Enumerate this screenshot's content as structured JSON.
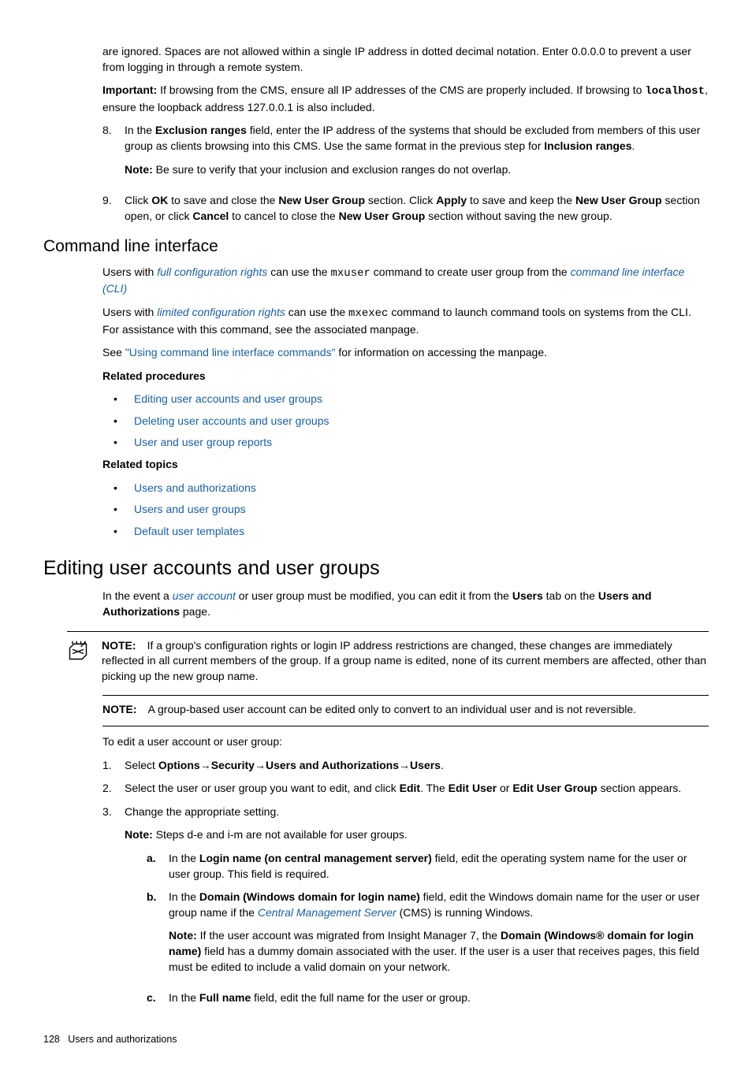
{
  "top": {
    "p1": "are ignored. Spaces are not allowed within a single IP address in dotted decimal notation. Enter 0.0.0.0 to prevent a user from logging in through a remote system.",
    "imp_label": "Important:",
    "imp_a": " If browsing from the CMS, ensure all IP addresses of the CMS are properly included. If browsing to ",
    "imp_mono": "localhost",
    "imp_b": ", ensure the loopback address 127.0.0.1 is also included."
  },
  "step8": {
    "num": "8.",
    "a": "In the ",
    "bold1": "Exclusion ranges",
    "b": " field, enter the IP address of the systems that should be excluded from members of this user group as clients browsing into this CMS. Use the same format in the previous step for ",
    "bold2": "Inclusion ranges",
    "c": ".",
    "note_label": "Note:",
    "note": " Be sure to verify that your inclusion and exclusion ranges do not overlap."
  },
  "step9": {
    "num": "9.",
    "a": "Click ",
    "b1": "OK",
    "b": " to save and close the ",
    "b2": "New User Group",
    "c": " section. Click ",
    "b3": "Apply",
    "d": " to save and keep the ",
    "b4": "New User Group",
    "e": " section open, or click ",
    "b5": "Cancel",
    "f": " to cancel to close the ",
    "b6": "New User Group",
    "g": " section without saving the new group."
  },
  "cli": {
    "heading": "Command line interface",
    "p1a": "Users with ",
    "p1link1": "full configuration rights",
    "p1b": " can use the ",
    "p1mono": "mxuser",
    "p1c": " command to create user group from the ",
    "p1link2": "command line interface (CLI)",
    "p2a": "Users with ",
    "p2link": "limited configuration rights",
    "p2b": " can use the ",
    "p2mono": "mxexec",
    "p2c": " command to launch command tools on systems from the CLI. For assistance with this command, see the associated manpage.",
    "p3a": "See ",
    "p3link": "\"Using command line interface commands\"",
    "p3b": " for information on accessing the manpage.",
    "rel_proc": "Related procedures",
    "proc1": "Editing user accounts and user groups",
    "proc2": "Deleting user accounts and user groups",
    "proc3": "User and user group reports",
    "rel_top": "Related topics",
    "top1": "Users and authorizations",
    "top2": "Users and user groups",
    "top3": "Default user templates"
  },
  "edit": {
    "heading": "Editing user accounts and user groups",
    "intro_a": "In the event a ",
    "intro_link": "user account",
    "intro_b": " or user group must be modified, you can edit it from the ",
    "intro_bold1": "Users",
    "intro_c": " tab on the ",
    "intro_bold2": "Users and Authorizations",
    "intro_d": " page.",
    "note1_label": "NOTE:",
    "note1": "If a group's configuration rights or login IP address restrictions are changed, these changes are immediately reflected in all current members of the group. If a group name is edited, none of its current members are affected, other than picking up the new group name.",
    "note2_label": "NOTE:",
    "note2": "A group-based user account can be edited only to convert to an individual user and is not reversible.",
    "lead": "To edit a user account or user group:"
  },
  "steps": {
    "s1": {
      "num": "1.",
      "a": "Select ",
      "b1": "Options",
      "arr": "→",
      "b2": "Security",
      "b3": "Users and Authorizations",
      "b4": "Users",
      "end": "."
    },
    "s2": {
      "num": "2.",
      "a": "Select the user or user group you want to edit, and click ",
      "b1": "Edit",
      "b": ". The ",
      "b2": "Edit User",
      "c": " or ",
      "b3": "Edit User Group",
      "d": " section appears."
    },
    "s3": {
      "num": "3.",
      "a": "Change the appropriate setting.",
      "note_label": "Note:",
      "note": " Steps d-e and i-m are not available for user groups."
    }
  },
  "sub": {
    "a": {
      "num": "a.",
      "t1": "In the ",
      "b1": "Login name (on central management server)",
      "t2": " field, edit the operating system name for the user or user group. This field is required."
    },
    "b": {
      "num": "b.",
      "t1": "In the ",
      "b1": "Domain (Windows domain for login name)",
      "t2": " field, edit the Windows domain name for the user or user group name if the ",
      "link": "Central Management Server",
      "t3": " (CMS) is running Windows.",
      "note_label": "Note:",
      "n1": " If the user account was migrated from Insight Manager 7, the ",
      "nb": "Domain (Windows® domain for login name)",
      "n2": " field has a dummy domain associated with the user. If the user is a user that receives pages, this field must be edited to include a valid domain on your network."
    },
    "c": {
      "num": "c.",
      "t1": "In the ",
      "b1": "Full name",
      "t2": " field, edit the full name for the user or group."
    }
  },
  "footer": {
    "page": "128",
    "title": "Users and authorizations"
  }
}
